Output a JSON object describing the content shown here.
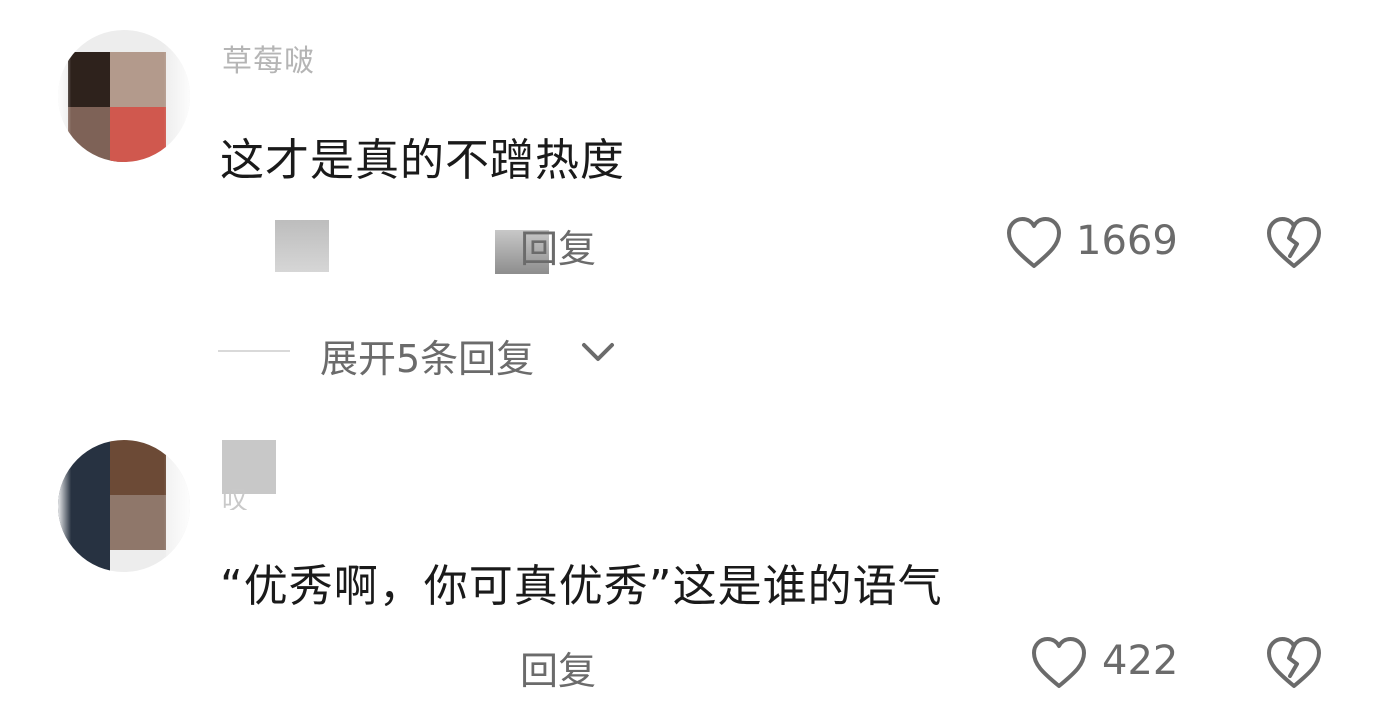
{
  "comments": [
    {
      "username": "草莓啵",
      "text": "这才是真的不蹭热度",
      "reply_label": "回复",
      "like_count": "1669",
      "avatar_colors": [
        "#2e221c",
        "#b39a8c",
        "#7e6257",
        "#d0584e"
      ]
    },
    {
      "username": "叹",
      "text": "“优秀啊，你可真优秀”这是谁的语气",
      "reply_label": "回复",
      "like_count": "422",
      "avatar_colors": [
        "#273241",
        "#6c4a36",
        "#3c4250",
        "#8f776a"
      ]
    }
  ],
  "expand_replies": {
    "label": "展开5条回复"
  },
  "icons": {
    "like": "heart-outline-icon",
    "dislike": "broken-heart-icon",
    "expand": "chevron-down-icon"
  },
  "colors": {
    "text_primary": "#1a1a1a",
    "text_secondary": "#6b6b6b",
    "icon_gray": "#6b6b6b",
    "divider": "#d9d9d9"
  }
}
